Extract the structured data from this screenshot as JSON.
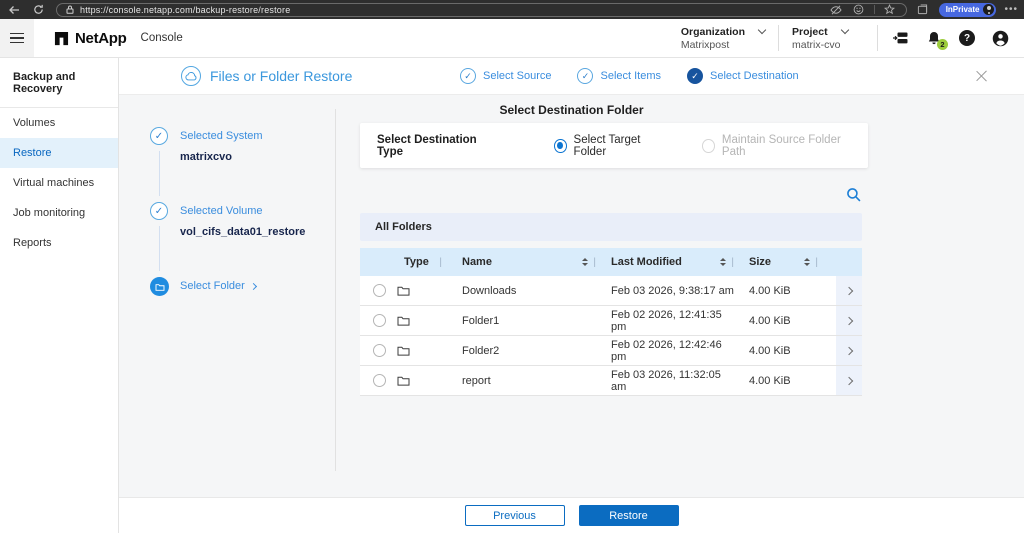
{
  "browser": {
    "url": "https://console.netapp.com/backup-restore/restore",
    "private_label": "InPrivate"
  },
  "header": {
    "brand": "NetApp",
    "app": "Console",
    "organization_label": "Organization",
    "organization_value": "Matrixpost",
    "project_label": "Project",
    "project_value": "matrix-cvo",
    "notifications_count": "2"
  },
  "sidebar": {
    "section_title": "Backup and Recovery",
    "items": [
      {
        "label": "Volumes",
        "active": false
      },
      {
        "label": "Restore",
        "active": true
      },
      {
        "label": "Virtual machines",
        "active": false
      },
      {
        "label": "Job monitoring",
        "active": false
      },
      {
        "label": "Reports",
        "active": false
      }
    ]
  },
  "wizard": {
    "title": "Files or Folder Restore",
    "steps": [
      {
        "label": "Select Source",
        "state": "complete"
      },
      {
        "label": "Select Items",
        "state": "complete"
      },
      {
        "label": "Select Destination",
        "state": "current"
      }
    ]
  },
  "progress": {
    "steps": [
      {
        "label": "Selected System",
        "value": "matrixcvo",
        "state": "complete"
      },
      {
        "label": "Selected Volume",
        "value": "vol_cifs_data01_restore",
        "state": "complete"
      },
      {
        "label": "Select Folder",
        "state": "current"
      }
    ]
  },
  "main": {
    "heading": "Select Destination Folder",
    "destination_type": {
      "label": "Select Destination Type",
      "options": [
        {
          "label": "Select Target Folder",
          "selected": true,
          "disabled": false
        },
        {
          "label": "Maintain Source Folder Path",
          "selected": false,
          "disabled": true
        }
      ]
    },
    "folders": {
      "group_label": "All Folders",
      "columns": {
        "type": "Type",
        "name": "Name",
        "modified": "Last Modified",
        "size": "Size"
      },
      "rows": [
        {
          "name": "Downloads",
          "modified": "Feb 03 2026, 9:38:17 am",
          "size": "4.00 KiB"
        },
        {
          "name": "Folder1",
          "modified": "Feb 02 2026, 12:41:35 pm",
          "size": "4.00 KiB"
        },
        {
          "name": "Folder2",
          "modified": "Feb 02 2026, 12:42:46 pm",
          "size": "4.00 KiB"
        },
        {
          "name": "report",
          "modified": "Feb 03 2026, 11:32:05 am",
          "size": "4.00 KiB"
        }
      ]
    }
  },
  "footer": {
    "previous_label": "Previous",
    "restore_label": "Restore"
  },
  "icons": {
    "back": "left-arrow",
    "refresh": "circular-arrow",
    "lock": "padlock",
    "search": "magnifier",
    "notifications": "bell",
    "help": "question-circle",
    "account": "person-circle",
    "workloads": "server-stack",
    "folder": "folder-outline",
    "step_complete": "check-circle",
    "close": "x"
  },
  "colors": {
    "brand_blue": "#0b6cc1",
    "accent_light_blue": "#3a97dd",
    "table_header_bg": "#d9ecfb",
    "group_header_bg": "#e9eef9",
    "content_bg": "#f5f6f7",
    "active_nav_bg": "#e3f1fb",
    "badge_green": "#9ccc3c"
  }
}
